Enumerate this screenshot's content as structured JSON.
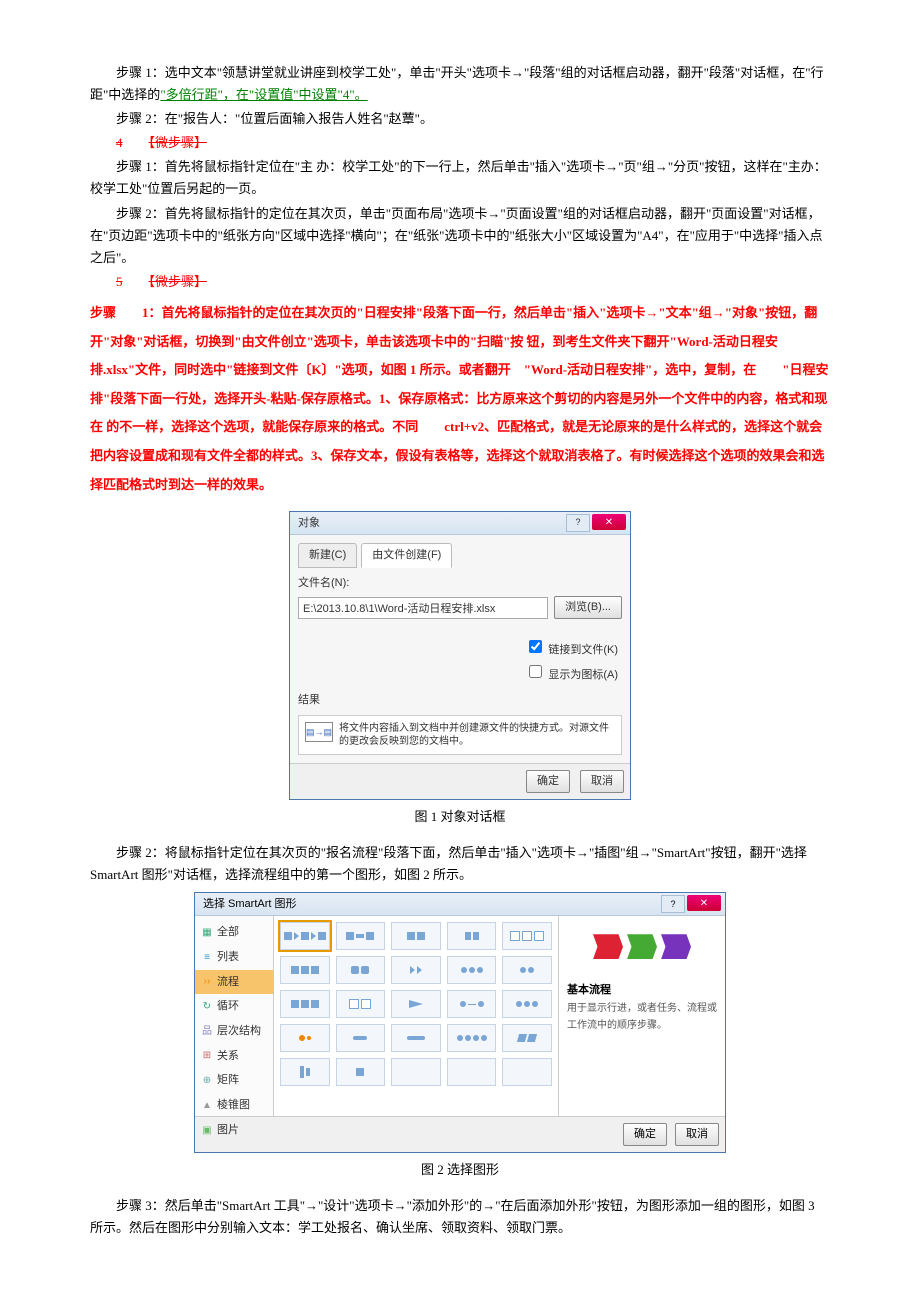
{
  "p1": "步骤 1：选中文本\"领慧讲堂就业讲座到校学工处\"，单击\"开头\"选项卡→\"段落\"组的对话框启动器，翻开\"段落\"对话框，在\"行距\"中选择的",
  "p1b": "\"多倍行距\"，在\"设置值\"中设置\"4\"。",
  "p2": "步骤 2：在\"报告人：\"位置后面输入报告人姓名\"赵蕈\"。",
  "h4_num": "4",
  "h4_strike": "【微步骤】",
  "p3": "步骤 1：首先将鼠标指针定位在\"主 办：校学工处\"的下一行上，然后单击\"插入\"选项卡→\"页\"组→\"分页\"按钮，这样在\"主办：校学工处\"位置后另起的一页。",
  "p4": "步骤 2：首先将鼠标指针的定位在其次页，单击\"页面布局\"选项卡→\"页面设置\"组的对话框启动器，翻开\"页面设置\"对话框，在\"页边距\"选项卡中的\"纸张方向\"区域中选择\"横向\"；在\"纸张\"选项卡中的\"纸张大小\"区域设置为\"A4\"，在\"应用于\"中选择\"插入点之后\"。",
  "h5_num": "5",
  "h5_strike": "【微步骤】",
  "red_a": "步骤　　1：首先将鼠标指针的定位在其次页的\"日程安排\"段落下面一行，然后单击\"插入\"选项卡→\"文本\"组→\"对象\"按钮，翻开\"对象\"对话框，切换到\"由文件创立\"选项卡，单击该选项卡中的\"扫瞄\"按 钮，到考生文件夹下翻开\"Word-活动日程安排.xlsx\"文件，同时选中\"链接到文件〔K〕\"选项，如图 1 所示。",
  "red_b": "或者翻开　\"Word-活动日程安排\"，选中，复制，在　　\"日程安排\"段落下面一行处，选择开头-粘贴-保存原格式。1、保存原格式：比方原来这个剪切的内容是另外一个文件中的内容，格式和现在 的不一样，选择这个选项，就能保存原来的格式。不同　　ctrl+v2、匹配格式，就是无论原来的是什么样式的，选择这个就会把内容设置成和现有文件全都的样式。3、保存文本，假设有表格等，选择这个就取消表格了。有时候选择这个选项的效果会和选择匹配格式时到达一样的效果。",
  "dlg1": {
    "title": "对象",
    "tab1": "新建(C)",
    "tab2": "由文件创建(F)",
    "filelabel": "文件名(N):",
    "filename": "E:\\2013.10.8\\1\\Word-活动日程安排.xlsx",
    "browse": "浏览(B)...",
    "chk1": "链接到文件(K)",
    "chk2": "显示为图标(A)",
    "result_label": "结果",
    "result_text": "将文件内容插入到文档中并创建源文件的快捷方式。对源文件的更改会反映到您的文档中。",
    "ok": "确定",
    "cancel": "取消"
  },
  "cap1": "图 1 对象对话框",
  "p5": "步骤 2：将鼠标指针定位在其次页的\"报名流程\"段落下面，然后单击\"插入\"选项卡→\"插图\"组→\"SmartArt\"按钮，翻开\"选择 SmartArt 图形\"对话框，选择流程组中的第一个图形，如图 2 所示。",
  "sa": {
    "title": "选择 SmartArt 图形",
    "cats": [
      "全部",
      "列表",
      "流程",
      "循环",
      "层次结构",
      "关系",
      "矩阵",
      "棱锥图",
      "图片"
    ],
    "sel_cat": 2,
    "preview_title": "基本流程",
    "preview_desc": "用于显示行进，或者任务、流程或工作流中的顺序步骤。",
    "ok": "确定",
    "cancel": "取消"
  },
  "cap2": "图 2 选择图形",
  "p6": "步骤 3：然后单击\"SmartArt 工具\"→\"设计\"选项卡→\"添加外形\"的→\"在后面添加外形\"按钮，为图形添加一组的图形，如图 3 所示。然后在图形中分别输入文本：学工处报名、确认坐席、领取资料、领取门票。"
}
